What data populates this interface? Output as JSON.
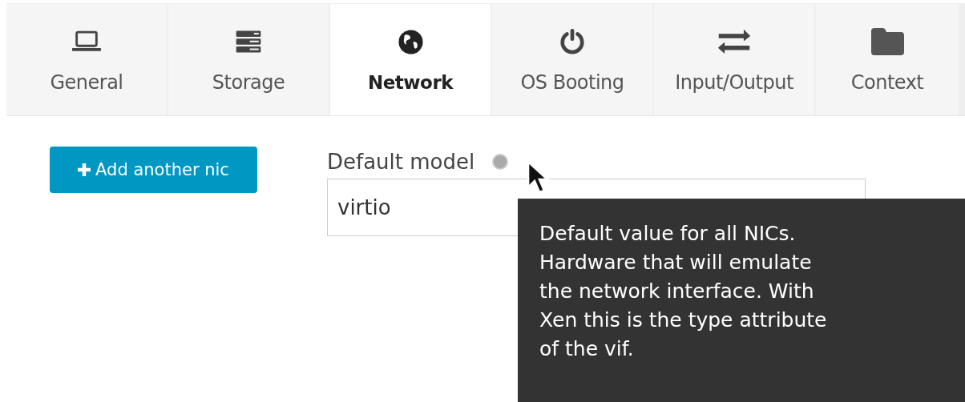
{
  "tabs": [
    {
      "label": "General",
      "selected": false
    },
    {
      "label": "Storage",
      "selected": false
    },
    {
      "label": "Network",
      "selected": true
    },
    {
      "label": "OS Booting",
      "selected": false
    },
    {
      "label": "Input/Output",
      "selected": false
    },
    {
      "label": "Context",
      "selected": false
    }
  ],
  "add_button": {
    "label": "Add another nic"
  },
  "default_model": {
    "label": "Default model",
    "value": "virtio"
  },
  "tooltip": {
    "text": "Default value for all NICs. Hardware that will emulate the network interface. With Xen this is the type attribute of the vif."
  }
}
